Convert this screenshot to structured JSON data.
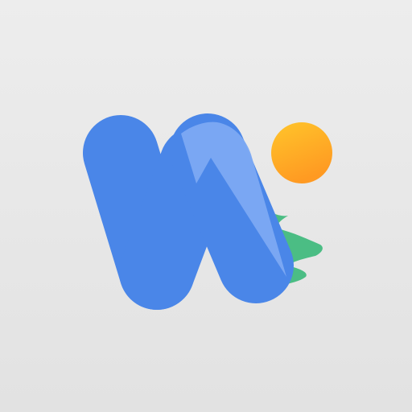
{
  "app_icon": {
    "name": "",
    "icon_semantic": "wallpaper-app-logo",
    "colors": {
      "background": "#e9e9e9",
      "w_primary": "#4a86e8",
      "w_highlight": "#79a8f2",
      "sun_top": "#ffc42e",
      "sun_bottom": "#ff9b24",
      "hills": "#4cbd84"
    }
  }
}
